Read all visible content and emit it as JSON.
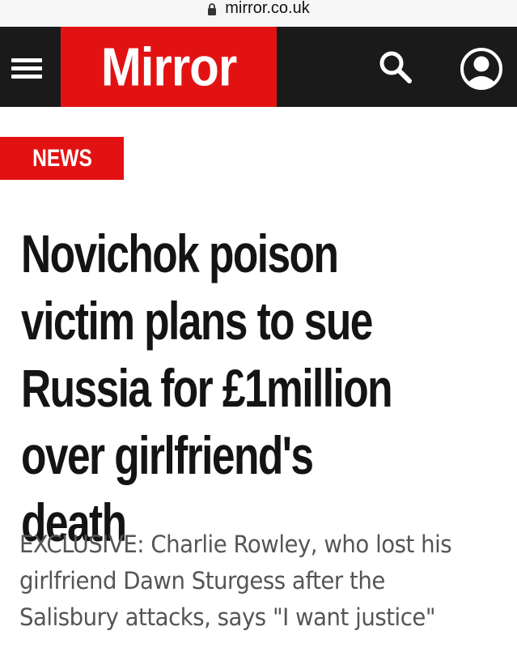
{
  "browser": {
    "url": "mirror.co.uk",
    "lock_icon": "lock-icon"
  },
  "header": {
    "menu_icon": "hamburger-menu-icon",
    "logo_text": "Mirror",
    "search_icon": "search-icon",
    "account_icon": "account-icon",
    "colors": {
      "bar": "#1a1a1a",
      "brand_red": "#e31212"
    }
  },
  "article": {
    "section_tag": "NEWS",
    "headline": "Novichok poison\nvictim plans to sue\nRussia for £1million\nover girlfriend's death",
    "standfirst": "EXCLUSIVE: Charlie Rowley, who lost his\ngirlfriend Dawn Sturgess after the\nSalisbury attacks, says \"I want justice\""
  }
}
